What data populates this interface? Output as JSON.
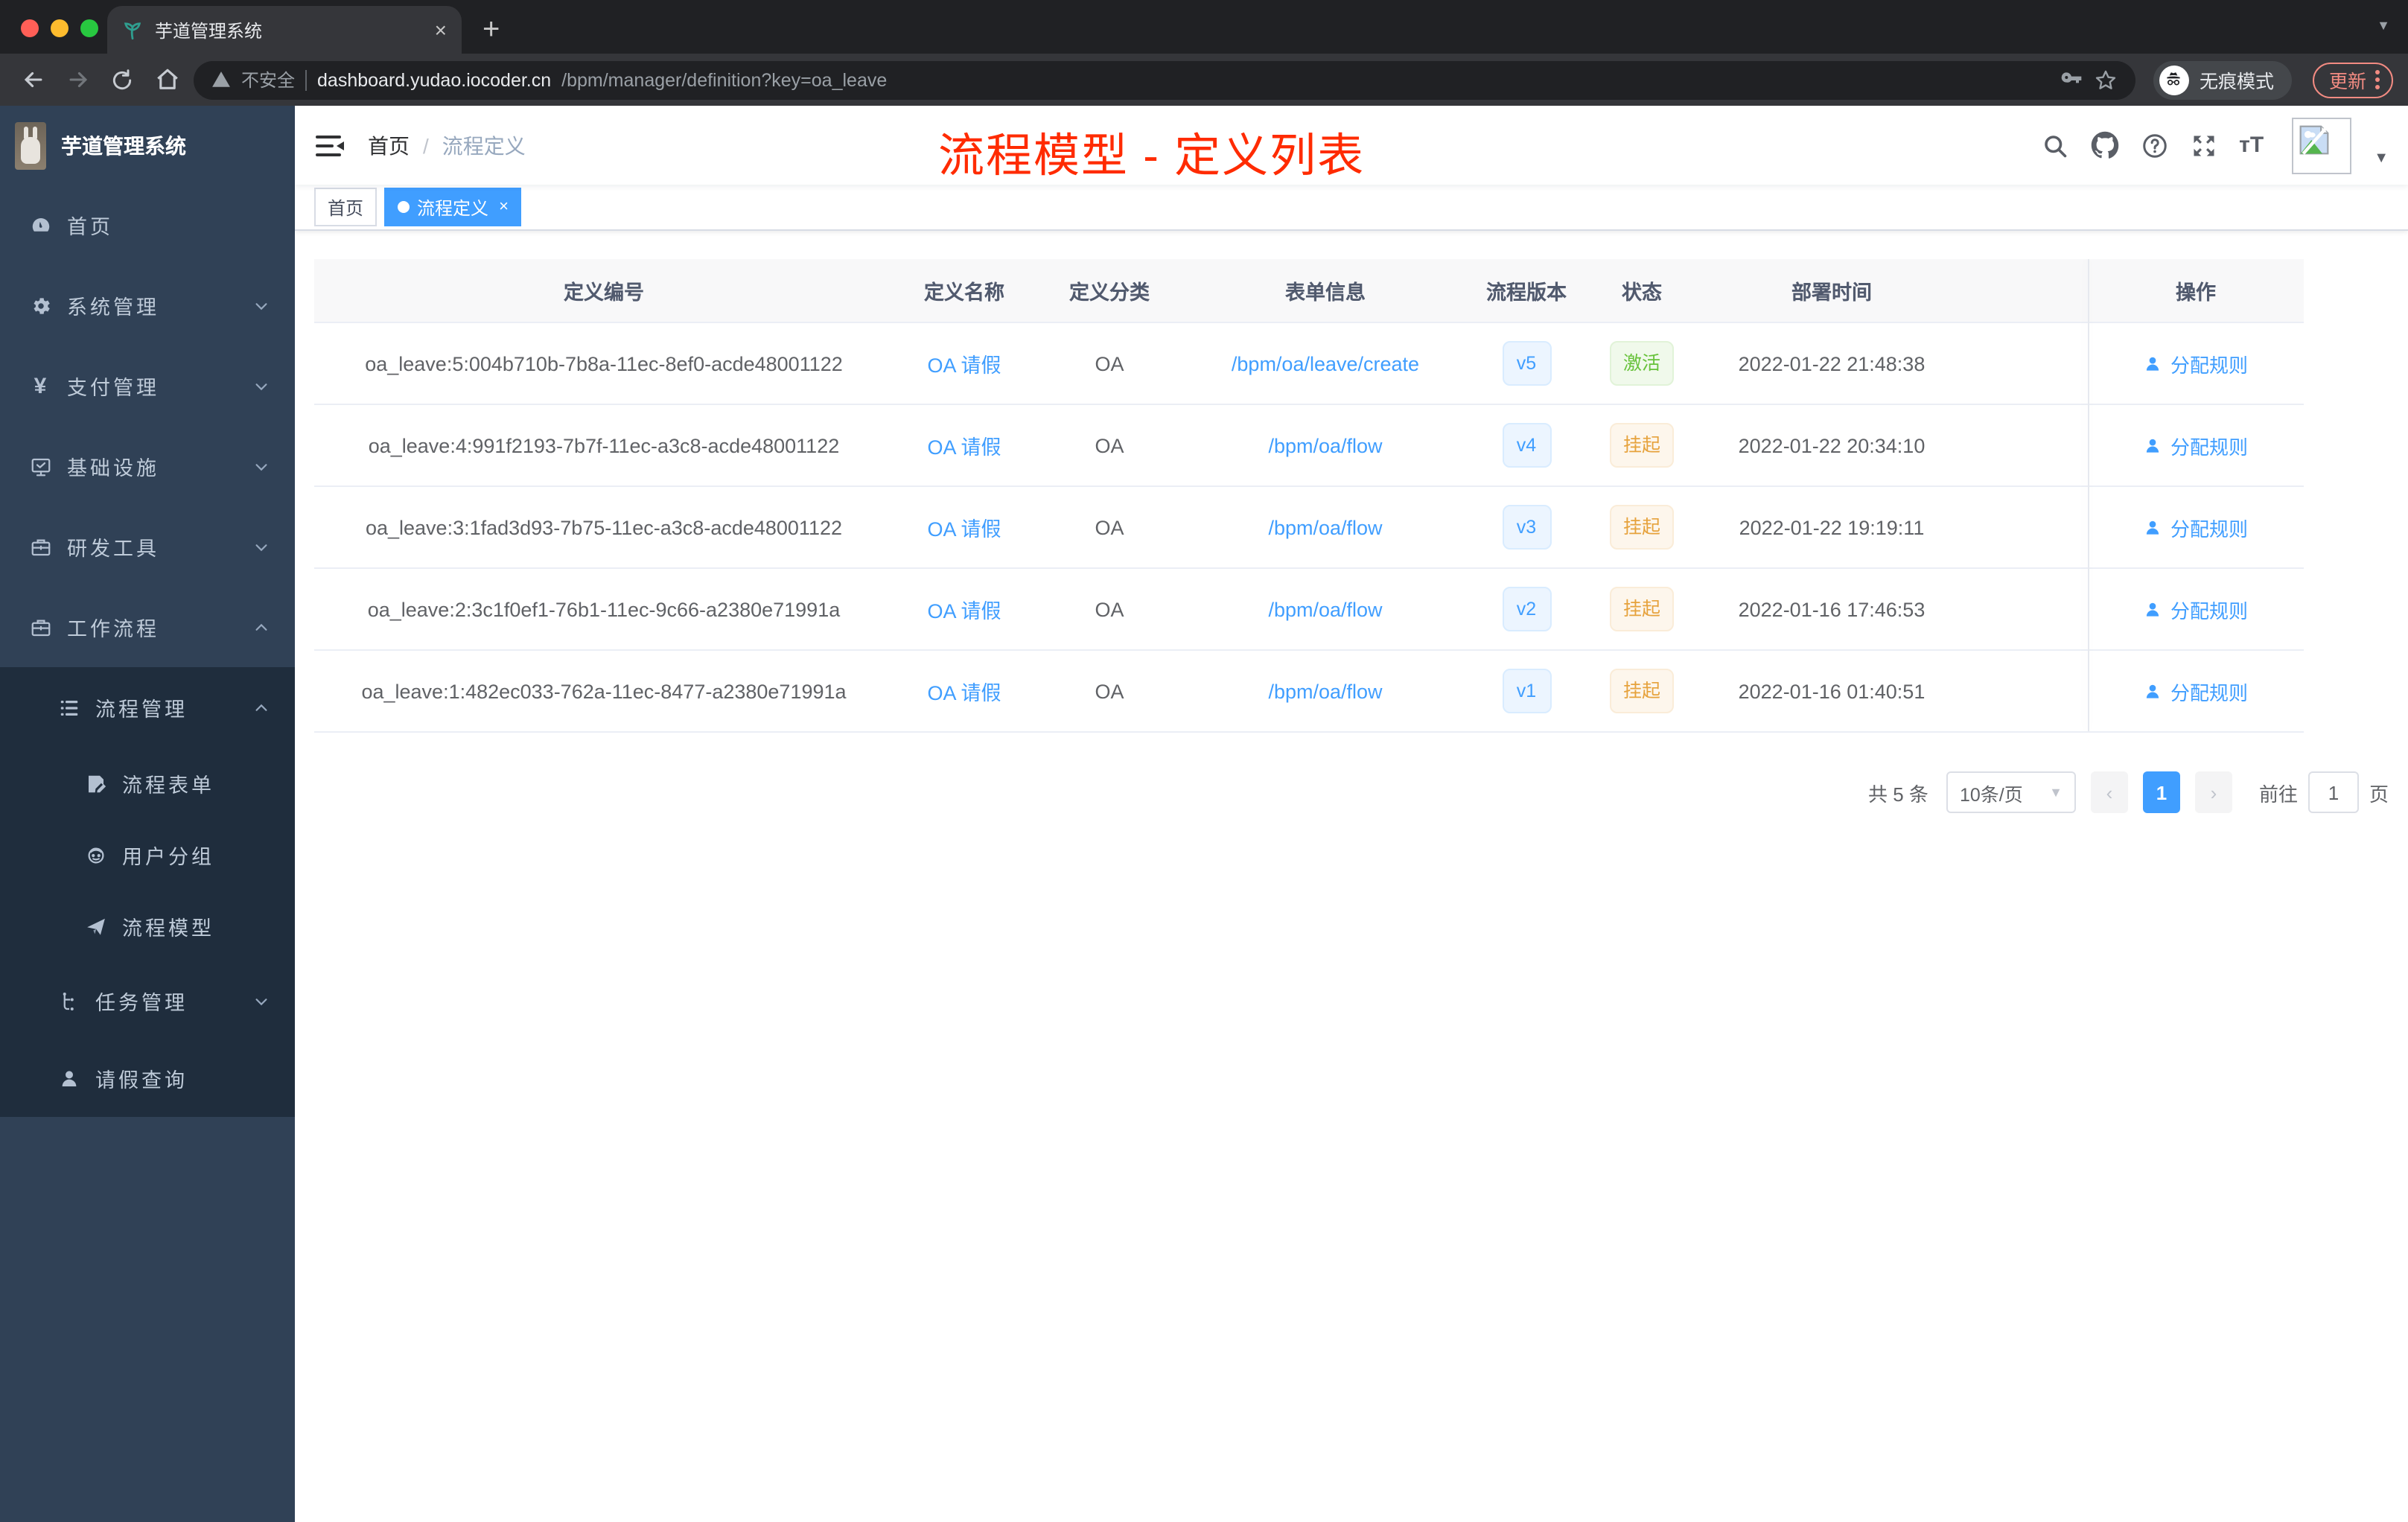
{
  "browser": {
    "tab_title": "芋道管理系统",
    "close_glyph": "×",
    "new_tab_glyph": "+",
    "address": {
      "warning_label": "不安全",
      "host": "dashboard.yudao.iocoder.cn",
      "path": "/bpm/manager/definition?key=oa_leave"
    },
    "incognito_label": "无痕模式",
    "update_label": "更新"
  },
  "sidebar": {
    "logo_title": "芋道管理系统",
    "items": [
      {
        "label": "首页",
        "icon": "dashboard-icon",
        "level": 1,
        "chevron": "",
        "dark": false
      },
      {
        "label": "系统管理",
        "icon": "gear-icon",
        "level": 1,
        "chevron": "down",
        "dark": false
      },
      {
        "label": "支付管理",
        "icon": "yuan-icon",
        "level": 1,
        "chevron": "down",
        "dark": false
      },
      {
        "label": "基础设施",
        "icon": "monitor-icon",
        "level": 1,
        "chevron": "down",
        "dark": false
      },
      {
        "label": "研发工具",
        "icon": "toolbox-icon",
        "level": 1,
        "chevron": "down",
        "dark": false
      },
      {
        "label": "工作流程",
        "icon": "toolbox-icon",
        "level": 1,
        "chevron": "up",
        "dark": false
      },
      {
        "label": "流程管理",
        "icon": "list-icon",
        "level": 2,
        "chevron": "up",
        "dark": true
      },
      {
        "label": "流程表单",
        "icon": "form-icon",
        "level": 3,
        "chevron": "",
        "dark": true
      },
      {
        "label": "用户分组",
        "icon": "robot-icon",
        "level": 3,
        "chevron": "",
        "dark": true
      },
      {
        "label": "流程模型",
        "icon": "paper-plane-icon",
        "level": 3,
        "chevron": "",
        "dark": true
      },
      {
        "label": "任务管理",
        "icon": "tree-icon",
        "level": 2,
        "chevron": "down",
        "dark": true
      },
      {
        "label": "请假查询",
        "icon": "user-icon",
        "level": 2,
        "chevron": "",
        "dark": true
      }
    ]
  },
  "navbar": {
    "breadcrumb_home": "首页",
    "breadcrumb_separator": "/",
    "breadcrumb_current": "流程定义",
    "annotation": "流程模型 - 定义列表"
  },
  "tags": [
    {
      "label": "首页",
      "active": false,
      "closable": false
    },
    {
      "label": "流程定义",
      "active": true,
      "closable": true
    }
  ],
  "table": {
    "columns": [
      "定义编号",
      "定义名称",
      "定义分类",
      "表单信息",
      "流程版本",
      "状态",
      "部署时间",
      "操作"
    ],
    "rows": [
      {
        "id": "oa_leave:5:004b710b-7b8a-11ec-8ef0-acde48001122",
        "name": "OA 请假",
        "category": "OA",
        "form": "/bpm/oa/leave/create",
        "version": "v5",
        "status": "激活",
        "status_type": "success",
        "deploy_time": "2022-01-22 21:48:38",
        "action": "分配规则"
      },
      {
        "id": "oa_leave:4:991f2193-7b7f-11ec-a3c8-acde48001122",
        "name": "OA 请假",
        "category": "OA",
        "form": "/bpm/oa/flow",
        "version": "v4",
        "status": "挂起",
        "status_type": "warning",
        "deploy_time": "2022-01-22 20:34:10",
        "action": "分配规则"
      },
      {
        "id": "oa_leave:3:1fad3d93-7b75-11ec-a3c8-acde48001122",
        "name": "OA 请假",
        "category": "OA",
        "form": "/bpm/oa/flow",
        "version": "v3",
        "status": "挂起",
        "status_type": "warning",
        "deploy_time": "2022-01-22 19:19:11",
        "action": "分配规则"
      },
      {
        "id": "oa_leave:2:3c1f0ef1-76b1-11ec-9c66-a2380e71991a",
        "name": "OA 请假",
        "category": "OA",
        "form": "/bpm/oa/flow",
        "version": "v2",
        "status": "挂起",
        "status_type": "warning",
        "deploy_time": "2022-01-16 17:46:53",
        "action": "分配规则"
      },
      {
        "id": "oa_leave:1:482ec033-762a-11ec-8477-a2380e71991a",
        "name": "OA 请假",
        "category": "OA",
        "form": "/bpm/oa/flow",
        "version": "v1",
        "status": "挂起",
        "status_type": "warning",
        "deploy_time": "2022-01-16 01:40:51",
        "action": "分配规则"
      }
    ]
  },
  "pagination": {
    "total_label": "共 5 条",
    "page_size_label": "10条/页",
    "current_page": "1",
    "goto_label": "前往",
    "goto_value": "1",
    "page_unit_label": "页"
  },
  "colors": {
    "accent_blue": "#409eff",
    "sidebar_bg": "#304156",
    "submenu_bg": "#1f2d3d",
    "annotation_red": "#ff2b00",
    "status_active_green": "#67c23a",
    "status_suspend_orange": "#e6a23c",
    "update_coral": "#f28b82"
  }
}
